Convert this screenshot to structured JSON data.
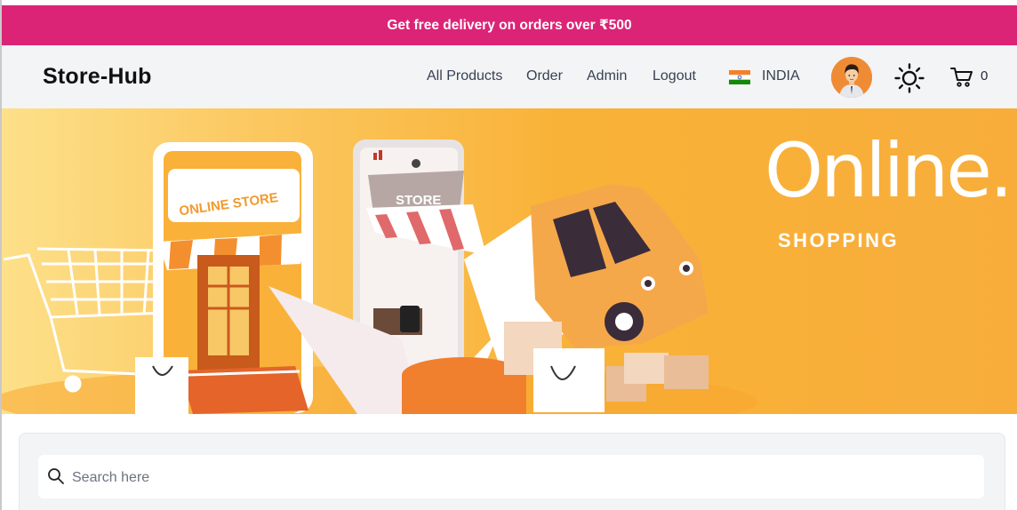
{
  "promo": {
    "text": "Get free delivery on orders over ₹500"
  },
  "header": {
    "brand": "Store-Hub",
    "nav": [
      {
        "label": "All Products"
      },
      {
        "label": "Order"
      },
      {
        "label": "Admin"
      },
      {
        "label": "Logout"
      }
    ],
    "country": "INDIA",
    "cart_count": "0",
    "icons": {
      "flag": "india-flag-icon",
      "theme": "sun-icon",
      "cart": "cart-icon",
      "avatar": "user-avatar"
    }
  },
  "hero": {
    "title": "Online.",
    "subtitle": "SHOPPING",
    "shop_sign": "ONLINE STORE",
    "phone_sign": "STORE"
  },
  "search": {
    "placeholder": "Search here"
  },
  "colors": {
    "promo": "#dc2477",
    "nav_bg": "#f3f4f6",
    "hero_orange": "#f9b238"
  }
}
